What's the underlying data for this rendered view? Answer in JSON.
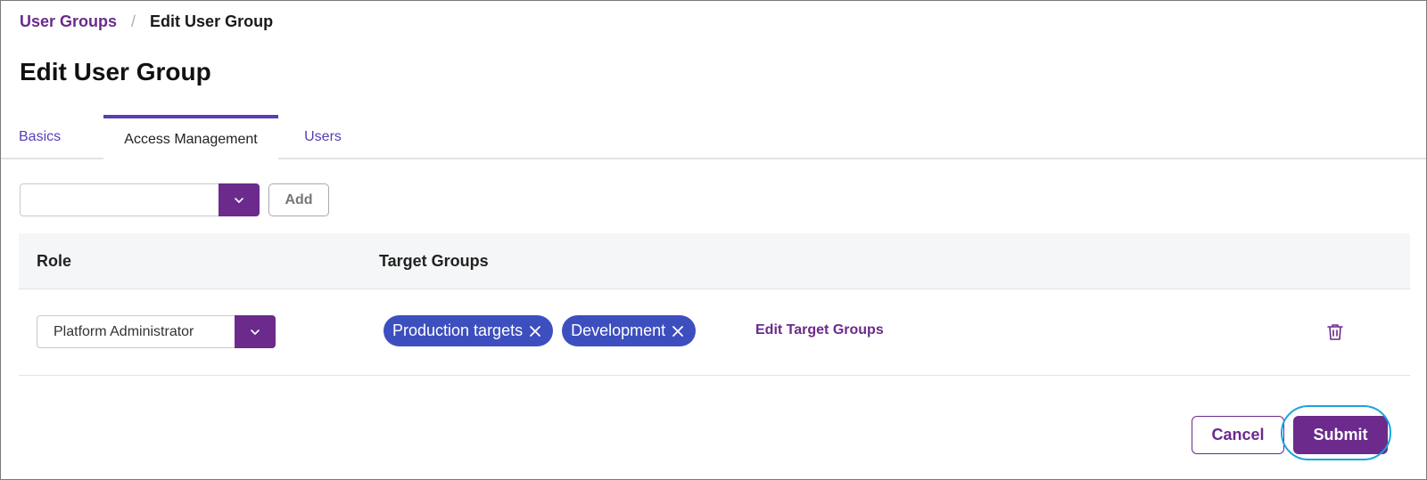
{
  "breadcrumb": {
    "parent": "User Groups",
    "separator": "/",
    "current": "Edit User Group"
  },
  "page": {
    "title": "Edit User Group"
  },
  "tabs": [
    {
      "label": "Basics",
      "active": false
    },
    {
      "label": "Access Management",
      "active": true
    },
    {
      "label": "Users",
      "active": false
    }
  ],
  "add_role": {
    "input_value": "",
    "add_label": "Add"
  },
  "table": {
    "columns": {
      "role": "Role",
      "target_groups": "Target Groups"
    },
    "rows": [
      {
        "role": "Platform Administrator",
        "target_groups": [
          "Production targets",
          "Development"
        ],
        "edit_label": "Edit Target Groups"
      }
    ]
  },
  "footer": {
    "cancel_label": "Cancel",
    "submit_label": "Submit"
  },
  "colors": {
    "accent_purple": "#6b2a8c",
    "tab_indicator": "#5b3db5",
    "chip_blue": "#3d4fbf",
    "highlight_ring": "#1aa3e0"
  },
  "icons": {
    "dropdown": "chevron-down-icon",
    "chip_remove": "close-icon",
    "row_delete": "trash-icon"
  }
}
